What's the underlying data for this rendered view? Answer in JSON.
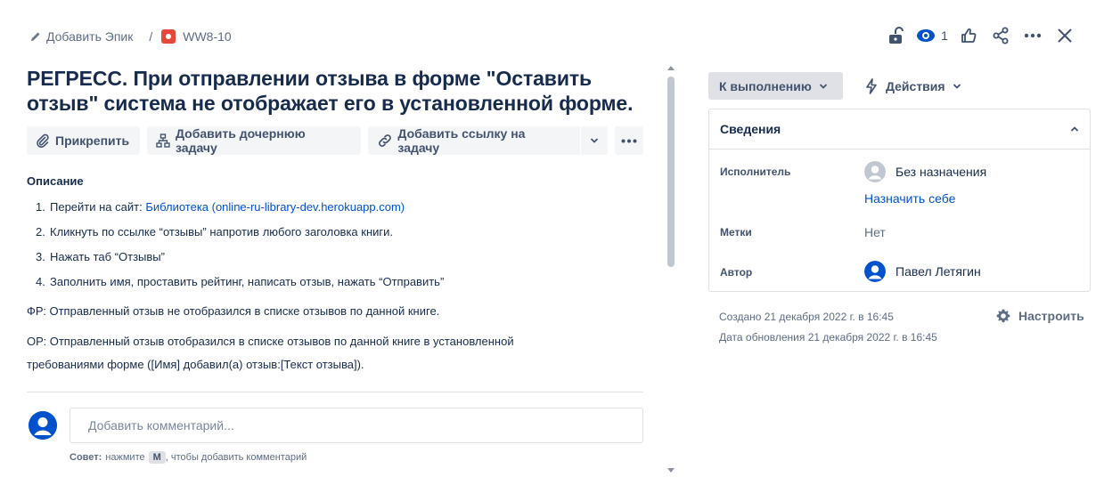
{
  "breadcrumb": {
    "add_epic": "Добавить Эпик",
    "separator": "/",
    "issue_key": "WW8-10"
  },
  "top_icons": {
    "watch_count": "1",
    "icons": [
      "unlock-icon",
      "eye-icon",
      "thumbs-up-icon",
      "share-icon",
      "more-icon",
      "close-icon"
    ]
  },
  "issue": {
    "title": "РЕГРЕСС. При отправлении отзыва в форме \"Оставить отзыв\" система не отображает его в установленной форме."
  },
  "actions": {
    "attach": "Прикрепить",
    "add_child": "Добавить дочернюю задачу",
    "add_link": "Добавить ссылку на задачу"
  },
  "description": {
    "label": "Описание",
    "steps": [
      {
        "num": "1.",
        "prefix": "Перейти на сайт: ",
        "link": "Библиотека (online-ru-library-dev.herokuapp.com)"
      },
      {
        "num": "2.",
        "text": "Кликнуть по ссылке “отзывы” напротив любого заголовка книги."
      },
      {
        "num": "3.",
        "text": "Нажать таб “Отзывы”"
      },
      {
        "num": "4.",
        "text": "Заполнить имя, проставить рейтинг, написать отзыв, нажать “Отправить”"
      }
    ],
    "actual": "ФР: Отправленный отзыв не отобразился в списке отзывов по данной книге.",
    "expected": "ОР: Отправленный отзыв отобразился в списке отзывов по данной книге в установленной требованиями форме ([Имя] добавил(а) отзыв:[Текст отзыва])."
  },
  "comment": {
    "placeholder": "Добавить комментарий...",
    "tip_bold": "Совет:",
    "tip_before": "нажмите",
    "tip_key": "M",
    "tip_after": ", чтобы добавить комментарий"
  },
  "sidebar": {
    "status": "К выполнению",
    "actions": "Действия",
    "details_title": "Сведения",
    "assignee_label": "Исполнитель",
    "assignee_value": "Без назначения",
    "assign_self": "Назначить себе",
    "labels_label": "Метки",
    "labels_value": "Нет",
    "reporter_label": "Автор",
    "reporter_value": "Павел Летягин",
    "created": "Создано 21 декабря 2022 г. в 16:45",
    "updated": "Дата обновления 21 декабря 2022 г. в 16:45",
    "configure": "Настроить"
  },
  "colors": {
    "accent": "#0052cc",
    "issue_type": "#e5493a",
    "text": "#172b4d",
    "muted": "#5e6c84"
  }
}
